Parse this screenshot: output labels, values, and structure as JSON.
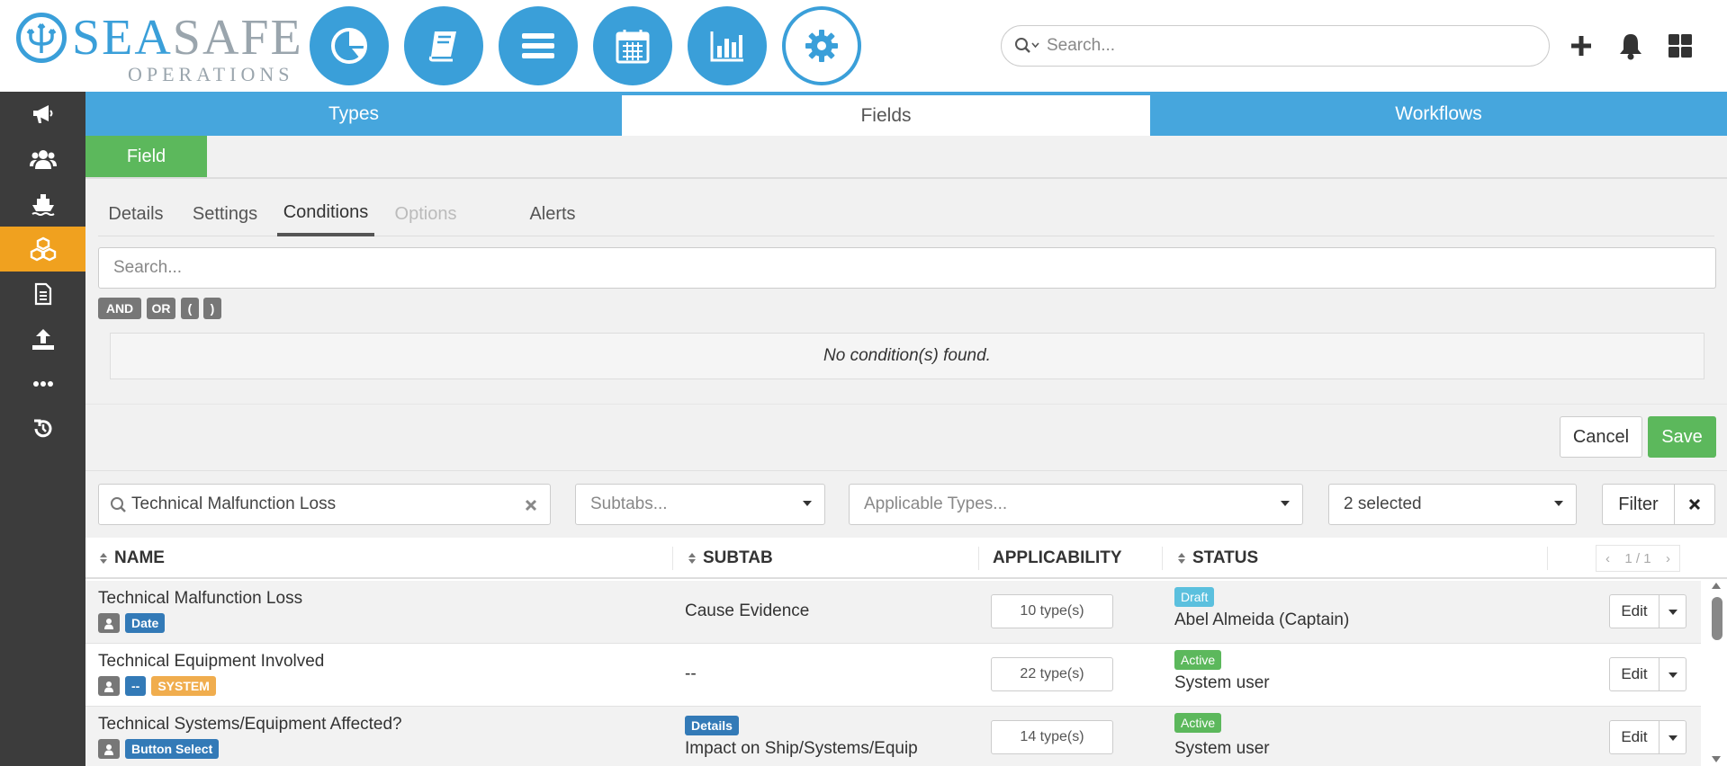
{
  "brand": {
    "name_part1": "SEA",
    "name_part2": "SAFE",
    "subtitle": "OPERATIONS",
    "accent": "#3a9fd9"
  },
  "top_nav": {
    "circles": [
      {
        "icon": "pie-chart-icon"
      },
      {
        "icon": "book-icon"
      },
      {
        "icon": "list-icon"
      },
      {
        "icon": "calendar-icon"
      },
      {
        "icon": "bar-chart-icon"
      },
      {
        "icon": "gear-icon",
        "active": true
      }
    ],
    "search_placeholder": "Search...",
    "right_icons": [
      "plus-icon",
      "bell-icon",
      "grid-icon"
    ]
  },
  "sidebar": {
    "items": [
      {
        "icon": "megaphone-icon"
      },
      {
        "icon": "users-icon"
      },
      {
        "icon": "ship-icon"
      },
      {
        "icon": "cubes-icon",
        "active": true
      },
      {
        "icon": "document-icon"
      },
      {
        "icon": "upload-icon"
      },
      {
        "icon": "more-icon"
      },
      {
        "icon": "history-icon"
      }
    ],
    "active_color": "#f0a11f"
  },
  "main_tabs": [
    {
      "label": "Types"
    },
    {
      "label": "Fields",
      "active": true
    },
    {
      "label": "Workflows"
    }
  ],
  "field_tab": {
    "label": "Field"
  },
  "sub_tabs": [
    {
      "label": "Details"
    },
    {
      "label": "Settings"
    },
    {
      "label": "Conditions",
      "active": true
    },
    {
      "label": "Options",
      "disabled": true
    },
    {
      "label": "Alerts"
    }
  ],
  "conditions": {
    "search_placeholder": "Search...",
    "operators": [
      "AND",
      "OR",
      "(",
      ")"
    ],
    "empty_message": "No condition(s) found."
  },
  "actions": {
    "cancel": "Cancel",
    "save": "Save"
  },
  "filters": {
    "name_value": "Technical Malfunction Loss",
    "subtabs_placeholder": "Subtabs...",
    "types_placeholder": "Applicable Types...",
    "status_value": "2 selected",
    "filter_label": "Filter"
  },
  "table": {
    "columns": {
      "name": "NAME",
      "subtab": "SUBTAB",
      "applicability": "APPLICABILITY",
      "status": "STATUS"
    },
    "pager": {
      "prev": "‹",
      "page": "1 / 1",
      "next": "›"
    },
    "rows": [
      {
        "name": "Technical Malfunction Loss",
        "type_badge": "Date",
        "system_badge": "",
        "subtab_badge": "",
        "subtab": "Cause Evidence",
        "applicability": "10 type(s)",
        "status": "Draft",
        "status_by": "Abel Almeida (Captain)",
        "edit": "Edit"
      },
      {
        "name": "Technical Equipment Involved",
        "type_badge": "--",
        "system_badge": "SYSTEM",
        "subtab_badge": "",
        "subtab": "--",
        "applicability": "22 type(s)",
        "status": "Active",
        "status_by": "System user",
        "edit": "Edit"
      },
      {
        "name": "Technical Systems/Equipment Affected?",
        "type_badge": "Button Select",
        "system_badge": "",
        "subtab_badge": "Details",
        "subtab": "Impact on Ship/Systems/Equip",
        "applicability": "14 type(s)",
        "status": "Active",
        "status_by": "System user",
        "edit": "Edit"
      }
    ]
  }
}
